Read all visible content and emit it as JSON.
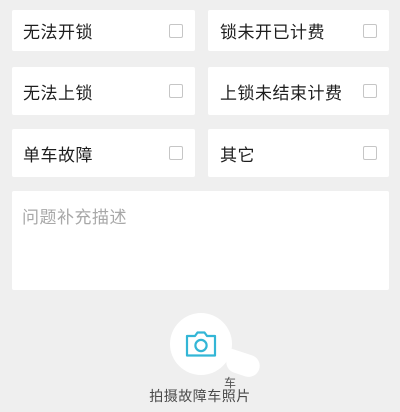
{
  "options": [
    {
      "label": "无法开锁",
      "checked": false
    },
    {
      "label": "锁未开已计费",
      "checked": false
    },
    {
      "label": "无法上锁",
      "checked": false
    },
    {
      "label": "上锁未结束计费",
      "checked": false
    },
    {
      "label": "单车故障",
      "checked": false
    },
    {
      "label": "其它",
      "checked": false
    }
  ],
  "description": {
    "placeholder": "问题补充描述",
    "value": ""
  },
  "photo": {
    "icon": "camera-icon",
    "label": "拍摄故障车照片",
    "overlay_char": "车"
  },
  "colors": {
    "accent": "#33b6d6",
    "background": "#efefef",
    "card": "#ffffff",
    "placeholder": "#a8a8a8"
  }
}
